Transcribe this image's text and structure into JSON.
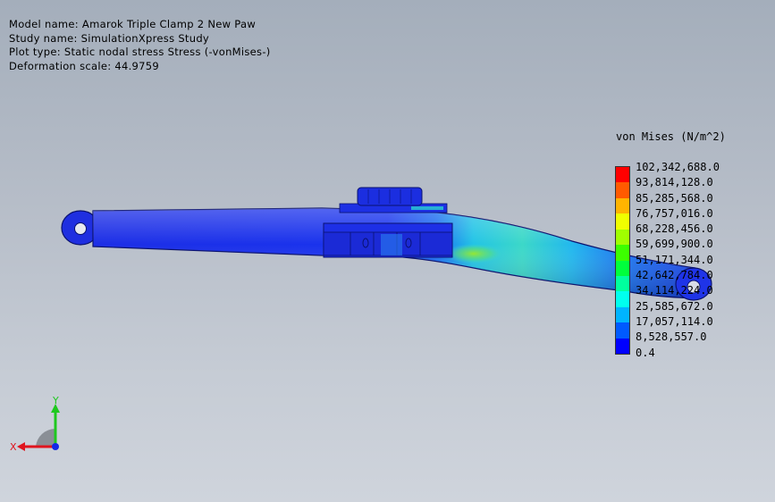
{
  "header": {
    "model_name": "Model name: Amarok Triple Clamp 2 New Paw",
    "study_name": "Study name: SimulationXpress Study",
    "plot_type": "Plot type: Static nodal stress Stress (-vonMises-)",
    "deformation_scale": "Deformation scale: 44.9759"
  },
  "legend": {
    "title": "von Mises (N/m^2)",
    "labels": [
      "102,342,688.0",
      "93,814,128.0",
      "85,285,568.0",
      "76,757,016.0",
      "68,228,456.0",
      "59,699,900.0",
      "51,171,344.0",
      "42,642,784.0",
      "34,114,224.0",
      "25,585,672.0",
      "17,057,114.0",
      "8,528,557.0",
      "0.4"
    ],
    "colors": [
      "#ff0000",
      "#ff5a00",
      "#ffb400",
      "#f0ff00",
      "#a0ff00",
      "#3cff00",
      "#00ff3c",
      "#00ff9e",
      "#00ffee",
      "#00b4ff",
      "#005aff",
      "#0000ff"
    ]
  },
  "triad": {
    "x_label": "X",
    "y_label": "Y",
    "x_color": "#e0141e",
    "y_color": "#1ec81e",
    "z_color": "#1428e6"
  }
}
